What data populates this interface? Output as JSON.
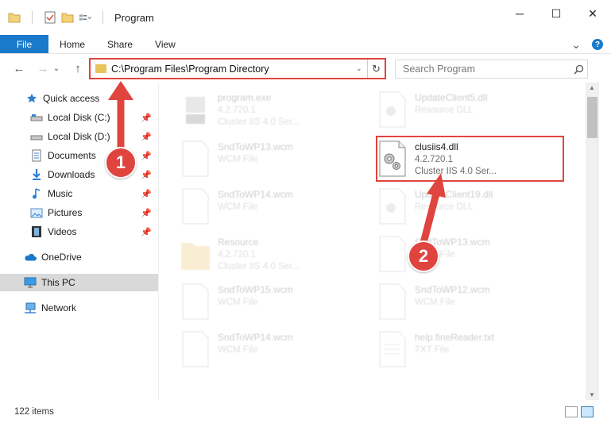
{
  "window": {
    "title": "Program",
    "minimize_label": "─",
    "maximize_label": "☐",
    "close_label": "✕"
  },
  "ribbon": {
    "tabs": [
      "File",
      "Home",
      "Share",
      "View"
    ],
    "expand_label": "⌄",
    "help_label": "?"
  },
  "nav": {
    "back_label": "←",
    "forward_label": "→",
    "recent_label": "⌄",
    "up_label": "↑"
  },
  "address": {
    "path": "C:\\Program Files\\Program Directory",
    "dropdown_label": "⌄",
    "refresh_label": "↻"
  },
  "search": {
    "placeholder": "Search Program"
  },
  "sidebar": {
    "items": [
      {
        "label": "Quick access"
      },
      {
        "label": "Local Disk (C:)"
      },
      {
        "label": "Local Disk (D:)"
      },
      {
        "label": "Documents"
      },
      {
        "label": "Downloads"
      },
      {
        "label": "Music"
      },
      {
        "label": "Pictures"
      },
      {
        "label": "Videos"
      },
      {
        "label": "OneDrive"
      },
      {
        "label": "This PC"
      },
      {
        "label": "Network"
      }
    ]
  },
  "files": [
    {
      "name": "program.exe",
      "line1": "4.2.720.1",
      "line2": "Cluster IIS 4.0 Ser..."
    },
    {
      "name": "UpdateClient5.dll",
      "line1": "Resource DLL",
      "line2": ""
    },
    {
      "name": "SndToWP13.wcm",
      "line1": "WCM File",
      "line2": ""
    },
    {
      "name": "clusiis4.dll",
      "line1": "4.2.720.1",
      "line2": "Cluster IIS 4.0 Ser..."
    },
    {
      "name": "SndToWP14.wcm",
      "line1": "WCM File",
      "line2": ""
    },
    {
      "name": "UpdateClient19.dll",
      "line1": "Resource DLL",
      "line2": ""
    },
    {
      "name": "Resource",
      "line1": "4.2.720.1",
      "line2": "Cluster IIS 4.0 Ser..."
    },
    {
      "name": "SndToWP13.wcm",
      "line1": "WCM File",
      "line2": ""
    },
    {
      "name": "SndToWP15.wcm",
      "line1": "WCM File",
      "line2": ""
    },
    {
      "name": "SndToWP12.wcm",
      "line1": "WCM File",
      "line2": ""
    },
    {
      "name": "SndToWP14.wcm",
      "line1": "WCM File",
      "line2": ""
    },
    {
      "name": "help.fineReader.txt",
      "line1": "TXT File",
      "line2": ""
    }
  ],
  "status": {
    "item_count": "122 items"
  },
  "callouts": {
    "one": "1",
    "two": "2"
  },
  "colors": {
    "accent": "#1979ca",
    "highlight": "#e0443e"
  }
}
